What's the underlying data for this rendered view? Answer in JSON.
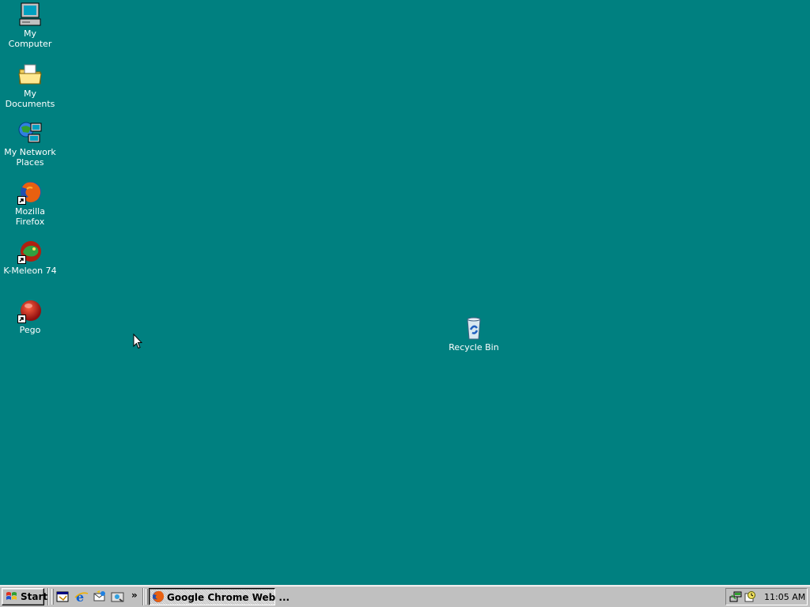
{
  "desktop": {
    "icons": [
      {
        "label": "My Computer",
        "icon": "my-computer-icon"
      },
      {
        "label": "My Documents",
        "icon": "my-documents-icon"
      },
      {
        "label": "My Network Places",
        "icon": "network-places-icon"
      },
      {
        "label": "Mozilla Firefox",
        "icon": "firefox-icon"
      },
      {
        "label": "K-Meleon 74",
        "icon": "k-meleon-icon"
      },
      {
        "label": "Pego",
        "icon": "pego-icon"
      },
      {
        "label": "Recycle Bin",
        "icon": "recycle-bin-icon"
      }
    ],
    "background_color": "#008080"
  },
  "taskbar": {
    "start_label": "Start",
    "quick_launch": [
      "show-desktop-icon",
      "internet-explorer-icon",
      "outlook-express-icon",
      "channels-icon"
    ],
    "overflow_label": "»",
    "tasks": [
      {
        "label": "Google Chrome Web ...",
        "icon": "firefox-icon"
      }
    ],
    "tray_icons": [
      "network-tray-icon",
      "scheduler-tray-icon"
    ],
    "clock": "11:05 AM"
  }
}
